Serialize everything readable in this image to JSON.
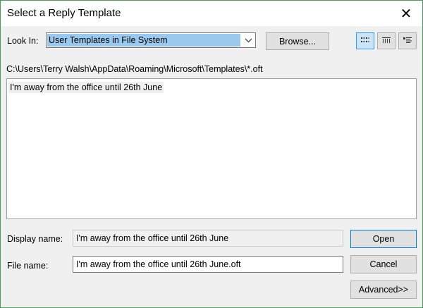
{
  "window": {
    "title": "Select a Reply Template",
    "close_glyph": "✕"
  },
  "look_in": {
    "label": "Look In:",
    "selected": "User Templates in File System",
    "browse_label": "Browse..."
  },
  "view_buttons": [
    "list-view-icon",
    "details-view-icon",
    "properties-view-icon"
  ],
  "path": "C:\\Users\\Terry Walsh\\AppData\\Roaming\\Microsoft\\Templates\\*.oft",
  "files": [
    {
      "name": "I'm away from the office until 26th June"
    }
  ],
  "display_name": {
    "label": "Display name:",
    "value": "I'm away from the office until 26th June"
  },
  "file_name": {
    "label": "File name:",
    "value": "I'm away from the office until 26th June.oft"
  },
  "buttons": {
    "open": "Open",
    "cancel": "Cancel",
    "advanced": "Advanced>>"
  },
  "colors": {
    "accent": "#0078d7",
    "selection": "#99c9ef",
    "window_border": "#4a9e5c"
  }
}
